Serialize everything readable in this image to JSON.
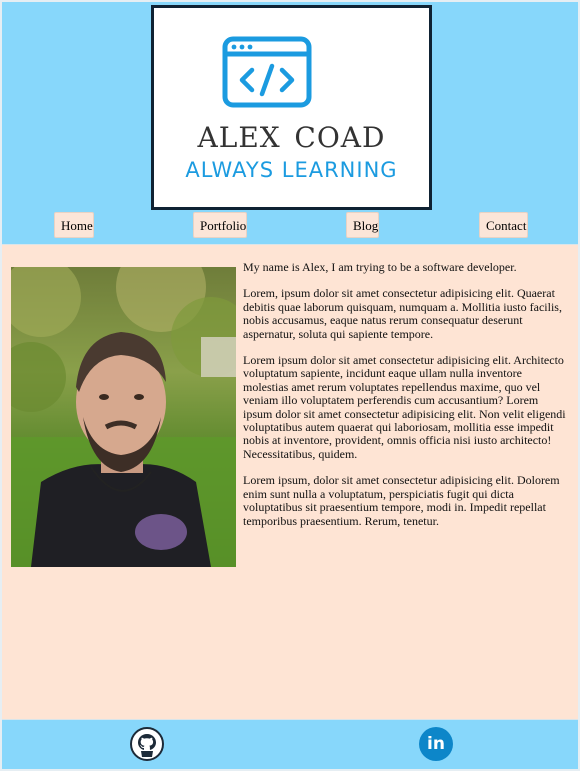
{
  "logo": {
    "name": "ALEX COAD",
    "tagline": "ALWAYS LEARNING",
    "icon": "code-window-icon",
    "colors": {
      "accent": "#1b9be0",
      "name": "#333333",
      "border": "#0f2233"
    }
  },
  "nav": {
    "items": [
      {
        "label": "Home"
      },
      {
        "label": "Portfolio"
      },
      {
        "label": "Blog"
      },
      {
        "label": "Contact"
      }
    ]
  },
  "main": {
    "photo_alt": "profile-photo",
    "paragraphs": [
      "My name is Alex, I am trying to be a software developer.",
      "Lorem, ipsum dolor sit amet consectetur adipisicing elit. Quaerat debitis quae laborum quisquam, numquam a. Mollitia iusto facilis, nobis accusamus, eaque natus rerum consequatur deserunt aspernatur, soluta qui sapiente tempore.",
      "Lorem ipsum dolor sit amet consectetur adipisicing elit. Architecto voluptatum sapiente, incidunt eaque ullam nulla inventore molestias amet rerum voluptates repellendus maxime, quo vel veniam illo voluptatem perferendis cum accusantium? Lorem ipsum dolor sit amet consectetur adipisicing elit. Non velit eligendi voluptatibus autem quaerat qui laboriosam, mollitia esse impedit nobis at inventore, provident, omnis officia nisi iusto architecto! Necessitatibus, quidem.",
      "Lorem ipsum, dolor sit amet consectetur adipisicing elit. Dolorem enim sunt nulla a voluptatum, perspiciatis fugit qui dicta voluptatibus sit praesentium tempore, modi in. Impedit repellat temporibus praesentium. Rerum, tenetur."
    ]
  },
  "footer": {
    "links": [
      {
        "icon": "github-icon"
      },
      {
        "icon": "linkedin-icon",
        "label": "in"
      }
    ]
  },
  "colors": {
    "header_bg": "#87d7fb",
    "main_bg": "#fee4d4",
    "nav_button_bg": "#fbe5d8"
  }
}
